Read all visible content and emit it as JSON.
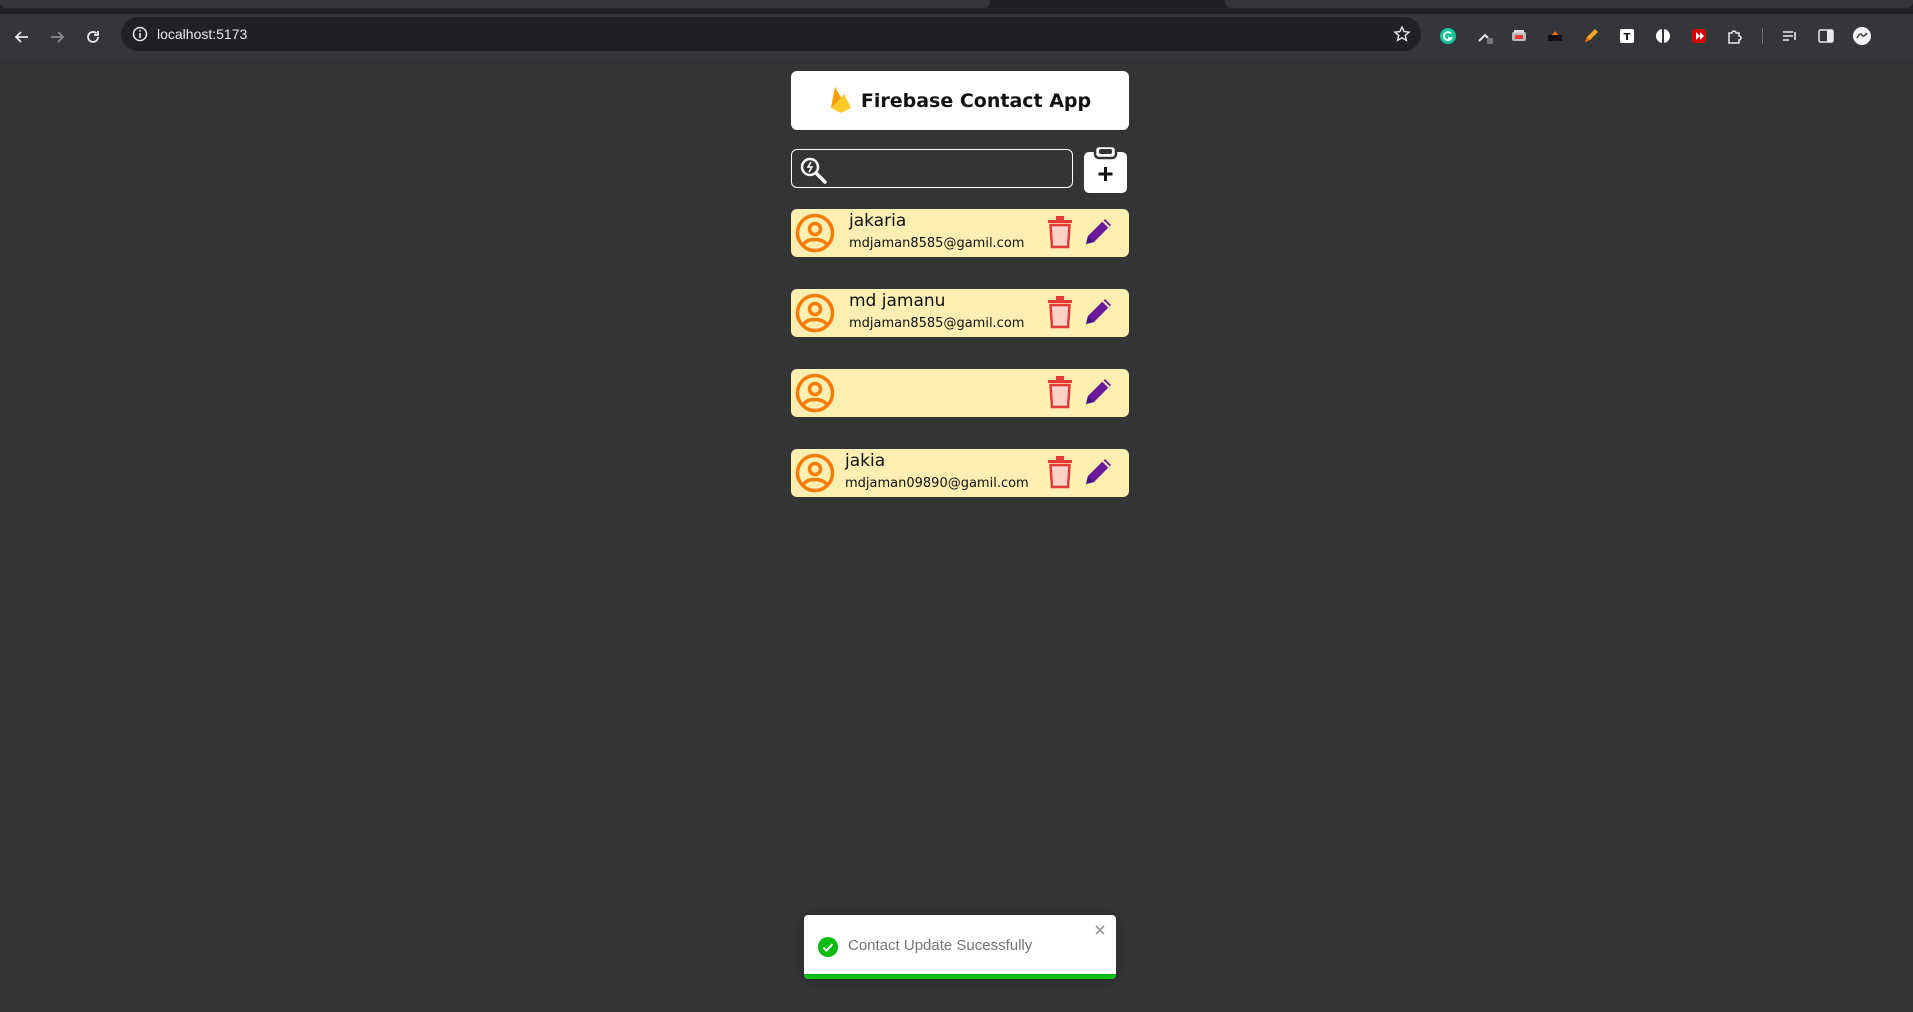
{
  "browser": {
    "url": "localhost:5173",
    "icons": [
      "back-icon",
      "forward-icon",
      "reload-icon",
      "site-info-icon",
      "bookmark-star-icon",
      "grammarly-icon",
      "extension-icon",
      "extensions-puzzle-icon",
      "reading-list-icon",
      "side-panel-icon",
      "profile-avatar-icon"
    ]
  },
  "app": {
    "title": "Firebase Contact App",
    "search": {
      "value": "",
      "placeholder": ""
    },
    "contacts": [
      {
        "name": "jakaria",
        "email": "mdjaman8585@gamil.com"
      },
      {
        "name": "md jamanu",
        "email": "mdjaman8585@gamil.com"
      },
      {
        "name": "",
        "email": ""
      },
      {
        "name": "jakia",
        "email": "mdjaman09890@gamil.com"
      }
    ]
  },
  "toast": {
    "message": "Contact Update Sucessfully",
    "type": "success"
  },
  "colors": {
    "page_bg": "#323436",
    "card_bg": "#fdeeb1",
    "avatar": "#f57c00",
    "trash": "#e53935",
    "pencil": "#6a1b9a",
    "toast_success": "#07bc0c"
  }
}
